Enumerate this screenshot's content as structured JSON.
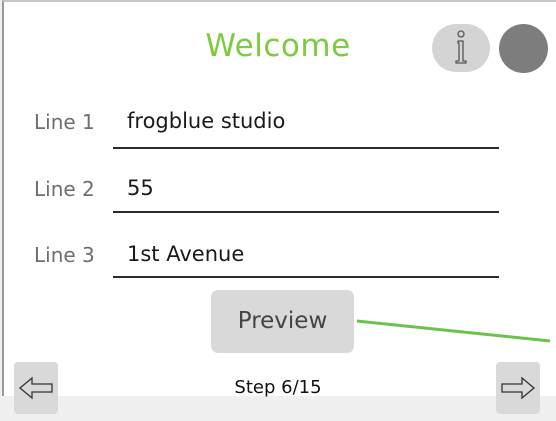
{
  "header": {
    "title": "Welcome",
    "info_icon": "info-icon",
    "status_indicator": "status-dot"
  },
  "form": {
    "rows": [
      {
        "label": "Line 1",
        "value": "frogblue studio"
      },
      {
        "label": "Line 2",
        "value": "55"
      },
      {
        "label": "Line 3",
        "value": "1st Avenue"
      }
    ]
  },
  "actions": {
    "preview_label": "Preview"
  },
  "navigation": {
    "step": "Step 6/15",
    "prev_icon": "arrow-left-icon",
    "next_icon": "arrow-right-icon"
  },
  "colors": {
    "title": "#7dcb3f",
    "connector": "#6cc24a",
    "status_dot": "#7d7d7d",
    "button_bg": "#d9d9d9"
  }
}
